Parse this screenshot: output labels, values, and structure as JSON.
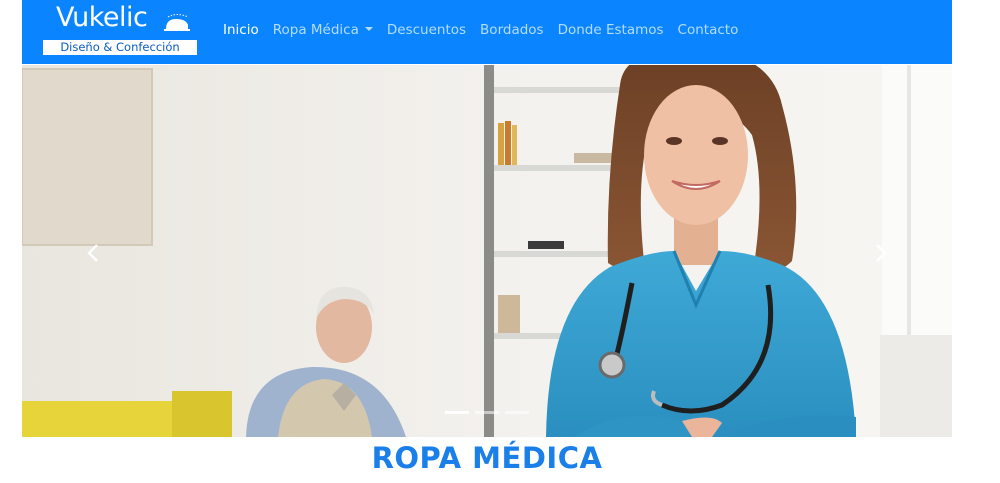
{
  "brand": {
    "name": "Vukelic",
    "tagline": "Diseño & Confección"
  },
  "nav": {
    "items": [
      {
        "label": "Inicio"
      },
      {
        "label": "Ropa Médica"
      },
      {
        "label": "Descuentos"
      },
      {
        "label": "Bordados"
      },
      {
        "label": "Donde Estamos"
      },
      {
        "label": "Contacto"
      }
    ]
  },
  "carousel": {
    "active_slide": 1,
    "slide_count": 3
  },
  "section": {
    "title": "ROPA MÉDICA"
  },
  "colors": {
    "navbar": "#0a85ff",
    "nav_active": "#ffffff",
    "nav_link": "#b4ddff",
    "title": "#1a7fe8"
  },
  "icons": {
    "prev": "chevron-left-icon",
    "next": "chevron-right-icon",
    "dropdown": "caret-down-icon"
  }
}
